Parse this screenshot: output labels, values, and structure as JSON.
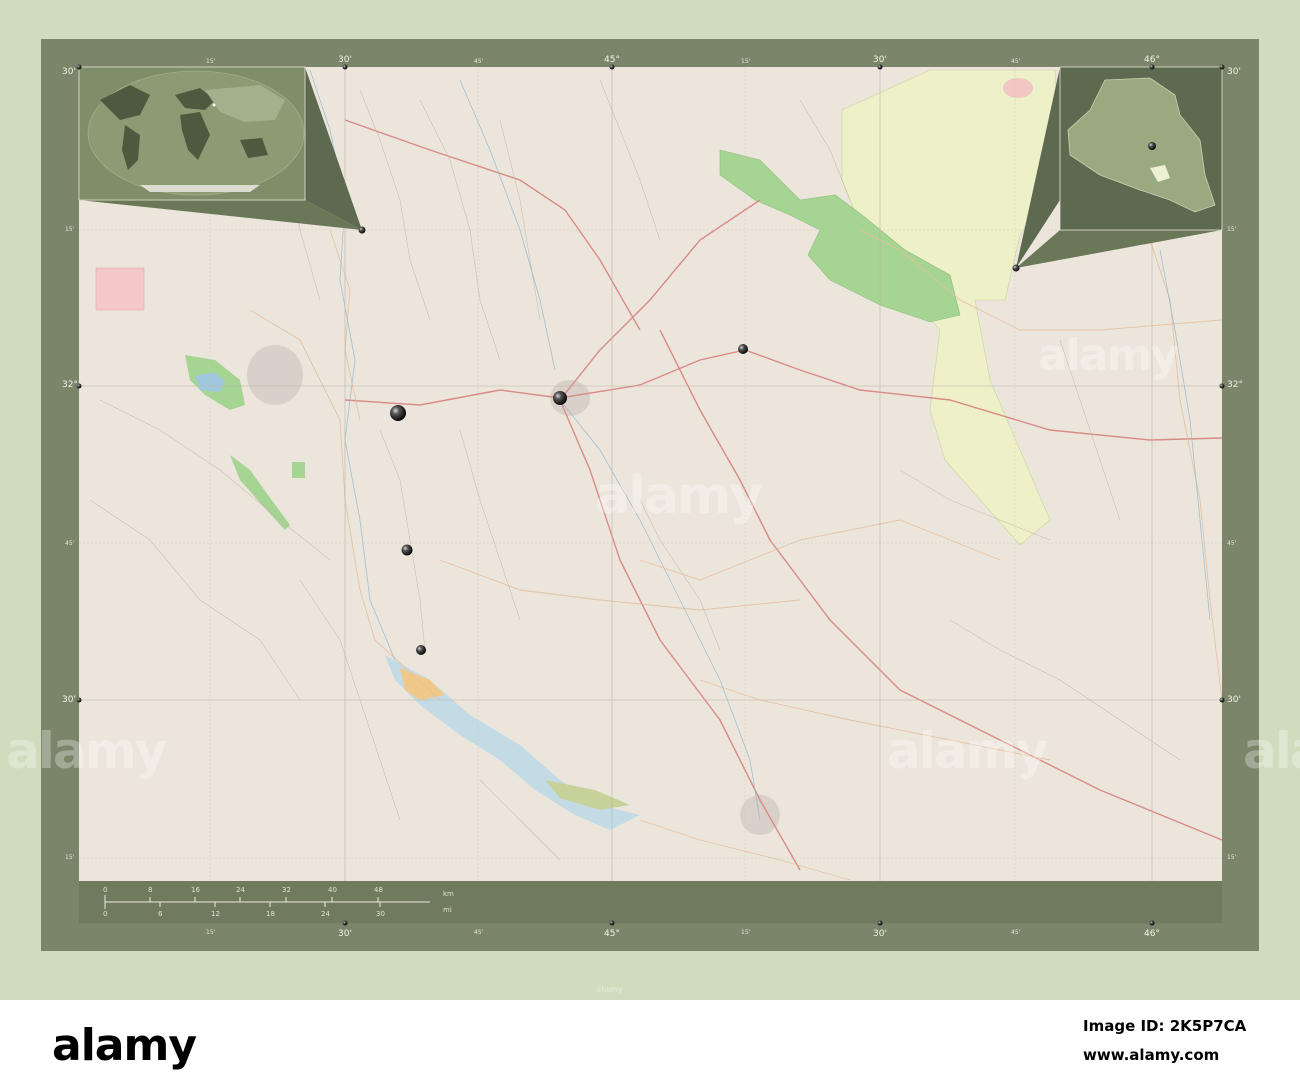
{
  "colors": {
    "page_bg": "#cfdcbd",
    "frame": "#7a856a",
    "map_bg": "#ece5dc",
    "green_area": "#a6d493",
    "yellow_area": "#eef0c8",
    "road": "#d98b87",
    "water": "#9fc8dc",
    "inset_bg": "#5e6a4f"
  },
  "latitude_labels": {
    "top": "30'",
    "mid": "32°",
    "bottom": "30'",
    "minor_15": "15'",
    "minor_45": "45'"
  },
  "longitude_labels": {
    "lon_30a": "30'",
    "lon_45": "45°",
    "lon_30b": "30'",
    "lon_46": "46°",
    "minor_15": "15'",
    "minor_45": "45'"
  },
  "scale_bar": {
    "km_ticks": [
      "0",
      "8",
      "16",
      "24",
      "32",
      "40",
      "48"
    ],
    "mi_ticks": [
      "0",
      "6",
      "12",
      "18",
      "24",
      "30"
    ],
    "km_unit": "km",
    "mi_unit": "mi"
  },
  "watermarks": [
    "alamy",
    "alamy",
    "alamy",
    "alamy",
    "alamy",
    "alamy"
  ],
  "footer": {
    "logo": "alamy",
    "image_id_label": "Image ID: 2K5P7CA",
    "url": "www.alamy.com"
  },
  "icons": {
    "city_marker": "sphere-marker-icon",
    "globe_inset": "world-globe-inset",
    "country_inset": "iraq-country-inset"
  }
}
